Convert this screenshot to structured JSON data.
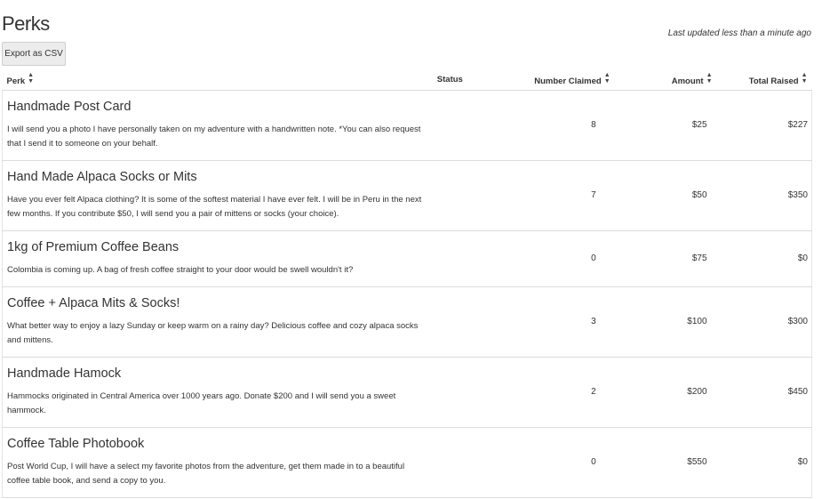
{
  "page": {
    "title": "Perks",
    "last_updated": "Last updated less than a minute ago",
    "export_label": "Export as CSV"
  },
  "table": {
    "headers": {
      "perk": "Perk",
      "status": "Status",
      "number_claimed": "Number Claimed",
      "amount": "Amount",
      "total_raised": "Total Raised"
    },
    "sort_icon": "sort-icon",
    "rows": [
      {
        "name": "Handmade Post Card",
        "description": "I will send you a photo I have personally taken on my adventure with a handwritten note.   *You can also request that I send it to someone on your behalf.",
        "status": "",
        "claimed": "8",
        "amount": "$25",
        "total": "$227"
      },
      {
        "name": "Hand Made Alpaca Socks or Mits",
        "description": "Have you ever felt Alpaca clothing? It is some of the softest material I have ever felt. I will be in Peru in the next few months.   If you contribute $50, I will send you a pair of mittens or socks (your choice).",
        "status": "",
        "claimed": "7",
        "amount": "$50",
        "total": "$350"
      },
      {
        "name": "1kg of Premium Coffee Beans",
        "description": "Colombia is coming up. A bag of fresh coffee straight to your door would be swell wouldn't it?",
        "status": "",
        "claimed": "0",
        "amount": "$75",
        "total": "$0"
      },
      {
        "name": "Coffee + Alpaca Mits & Socks!",
        "description": "What better way to enjoy a lazy Sunday or keep warm on a rainy day? Delicious coffee and cozy alpaca socks and mittens.",
        "status": "",
        "claimed": "3",
        "amount": "$100",
        "total": "$300"
      },
      {
        "name": "Handmade Hamock",
        "description": "Hammocks originated in Central America over 1000 years ago. Donate $200 and I will send you a sweet hammock.",
        "status": "",
        "claimed": "2",
        "amount": "$200",
        "total": "$450"
      },
      {
        "name": "Coffee Table Photobook",
        "description": "Post World Cup, I will have a select my favorite photos from the adventure, get them made in to a beautiful coffee table book, and send a copy to you.",
        "status": "",
        "claimed": "0",
        "amount": "$550",
        "total": "$0"
      }
    ]
  }
}
